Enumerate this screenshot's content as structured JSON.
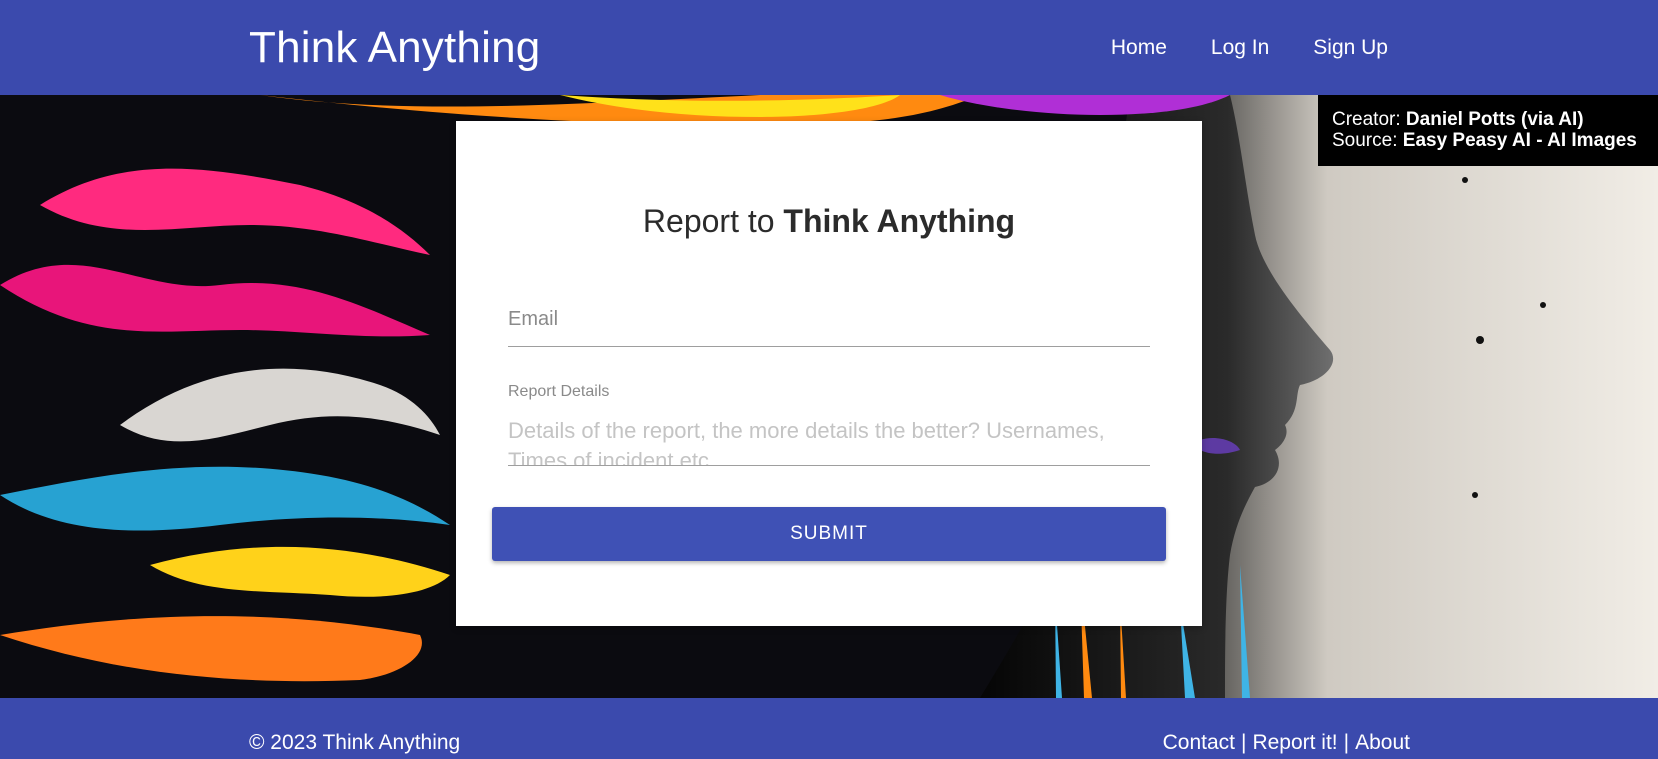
{
  "header": {
    "brand": "Think Anything",
    "nav": [
      {
        "label": "Home"
      },
      {
        "label": "Log In"
      },
      {
        "label": "Sign Up"
      }
    ]
  },
  "credit": {
    "creator_label": "Creator:",
    "creator_value": "Daniel Potts (via AI)",
    "source_label": "Source:",
    "source_value": "Easy Peasy AI - AI Images"
  },
  "form": {
    "title_prefix": "Report to",
    "title_brand": "Think Anything",
    "email_placeholder": "Email",
    "details_label": "Report Details",
    "details_placeholder": "Details of the report, the more details the better? Usernames, Times of incident etc.",
    "submit_label": "SUBMIT"
  },
  "footer": {
    "copyright": "© 2023 Think Anything",
    "links": [
      {
        "label": "Contact"
      },
      {
        "label": "Report it!"
      },
      {
        "label": "About"
      }
    ],
    "separator": "|"
  },
  "colors": {
    "primary": "#3b4aad",
    "button": "#3f51b5",
    "credit_bg": "#000000"
  }
}
